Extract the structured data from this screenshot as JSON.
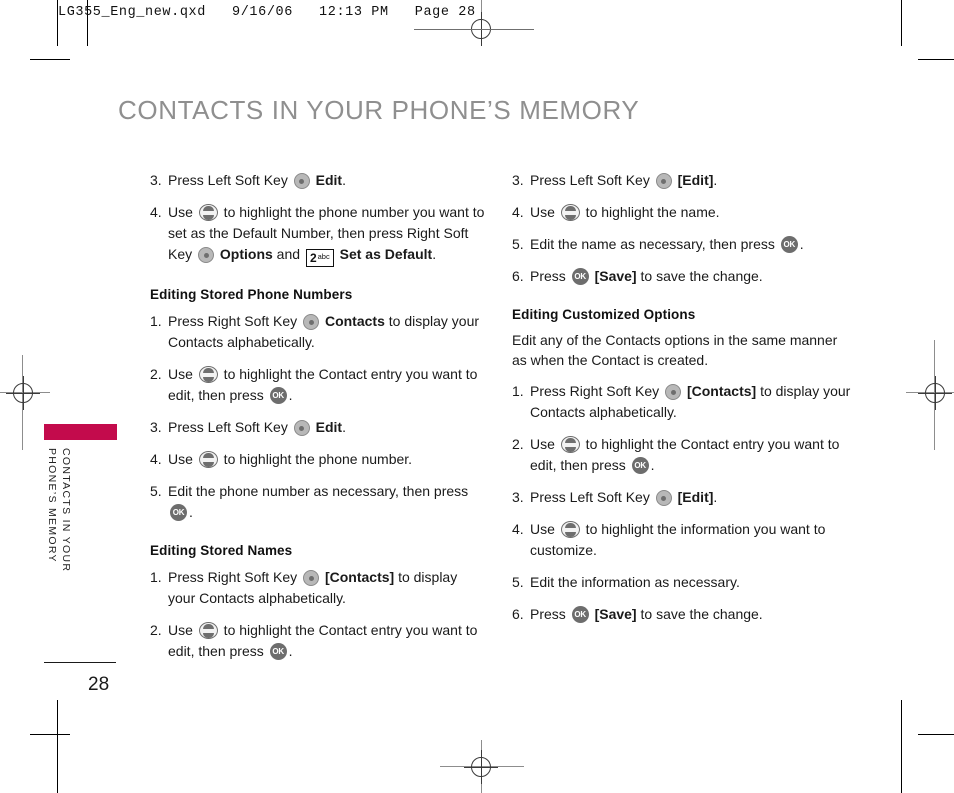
{
  "prepress": {
    "file_header": "LG355_Eng_new.qxd   9/16/06   12:13 PM   Page 28"
  },
  "page": {
    "title": "CONTACTS IN YOUR PHONE’S MEMORY",
    "side_tab_text": "CONTACTS IN YOUR\nPHONE’S MEMORY",
    "side_tab_color": "#c30b4c",
    "folio": "28"
  },
  "icons": {
    "soft_key": "soft-key-icon",
    "nav_key": "navigation-key-icon",
    "ok_key": "ok-key-icon",
    "ok_label": "OK",
    "num_key_digit": "2",
    "num_key_letters": "abc"
  },
  "left_column": {
    "steps_top": [
      {
        "num": "3.",
        "pre": "Press Left Soft Key ",
        "icon": "soft",
        "mid": " ",
        "bold1": "Edit",
        "post": "."
      },
      {
        "num": "4.",
        "pre": "Use ",
        "icon": "nav",
        "mid": " to highlight the phone number you want to set as the Default Number, then press  Right Soft Key ",
        "icon2": "soft",
        "bold1": "Options",
        "between": " and ",
        "icon3": "num",
        "bold2": "Set as Default",
        "post": "."
      }
    ],
    "section_phone_numbers": {
      "heading": "Editing Stored Phone Numbers",
      "steps": [
        {
          "num": "1.",
          "pre": "Press Right Soft Key ",
          "icon": "soft",
          "bold1": "Contacts",
          "post": " to display your Contacts alphabetically."
        },
        {
          "num": "2.",
          "pre": "Use ",
          "icon": "nav",
          "mid": " to highlight the Contact entry you want to edit, then press ",
          "icon2": "ok",
          "post": "."
        },
        {
          "num": "3.",
          "pre": "Press Left Soft Key ",
          "icon": "soft",
          "bold1": "Edit",
          "post": "."
        },
        {
          "num": "4.",
          "pre": "Use ",
          "icon": "nav",
          "mid": " to highlight the phone number.",
          "post": ""
        },
        {
          "num": "5.",
          "pre": "Edit the phone number as necessary, then press ",
          "icon": "ok",
          "post": "."
        }
      ]
    },
    "section_names": {
      "heading": "Editing Stored Names",
      "steps": [
        {
          "num": "1.",
          "pre": "Press Right Soft Key ",
          "icon": "soft",
          "bold1": "[Contacts]",
          "post": " to display your Contacts alphabetically."
        },
        {
          "num": "2.",
          "pre": "Use ",
          "icon": "nav",
          "mid": " to highlight the Contact entry you want to edit, then press ",
          "icon2": "ok",
          "post": "."
        }
      ]
    }
  },
  "right_column": {
    "steps_top": [
      {
        "num": "3.",
        "pre": "Press Left Soft Key ",
        "icon": "soft",
        "bold1": "[Edit]",
        "post": "."
      },
      {
        "num": "4.",
        "pre": "Use ",
        "icon": "nav",
        "mid": " to highlight the name.",
        "post": ""
      },
      {
        "num": "5.",
        "pre": "Edit the name as necessary, then press ",
        "icon": "ok",
        "post": "."
      },
      {
        "num": "6.",
        "pre": "Press ",
        "icon": "ok",
        "bold1": "[Save]",
        "post": " to save the change."
      }
    ],
    "section_customized": {
      "heading": "Editing Customized Options",
      "intro": "Edit any of the Contacts options in the same manner as when the Contact is created.",
      "steps": [
        {
          "num": "1.",
          "pre": "Press Right Soft Key ",
          "icon": "soft",
          "bold1": "[Contacts]",
          "post": " to display your Contacts alphabetically."
        },
        {
          "num": "2.",
          "pre": "Use ",
          "icon": "nav",
          "mid": " to highlight the Contact entry you want to edit, then press ",
          "icon2": "ok",
          "post": "."
        },
        {
          "num": "3.",
          "pre": "Press Left Soft Key ",
          "icon": "soft",
          "bold1": "[Edit]",
          "post": "."
        },
        {
          "num": "4.",
          "pre": "Use ",
          "icon": "nav",
          "mid": " to highlight the information you want to customize.",
          "post": ""
        },
        {
          "num": "5.",
          "pre": "Edit the information as necessary.",
          "post": ""
        },
        {
          "num": "6.",
          "pre": "Press ",
          "icon": "ok",
          "bold1": "[Save]",
          "post": " to save the change."
        }
      ]
    }
  }
}
